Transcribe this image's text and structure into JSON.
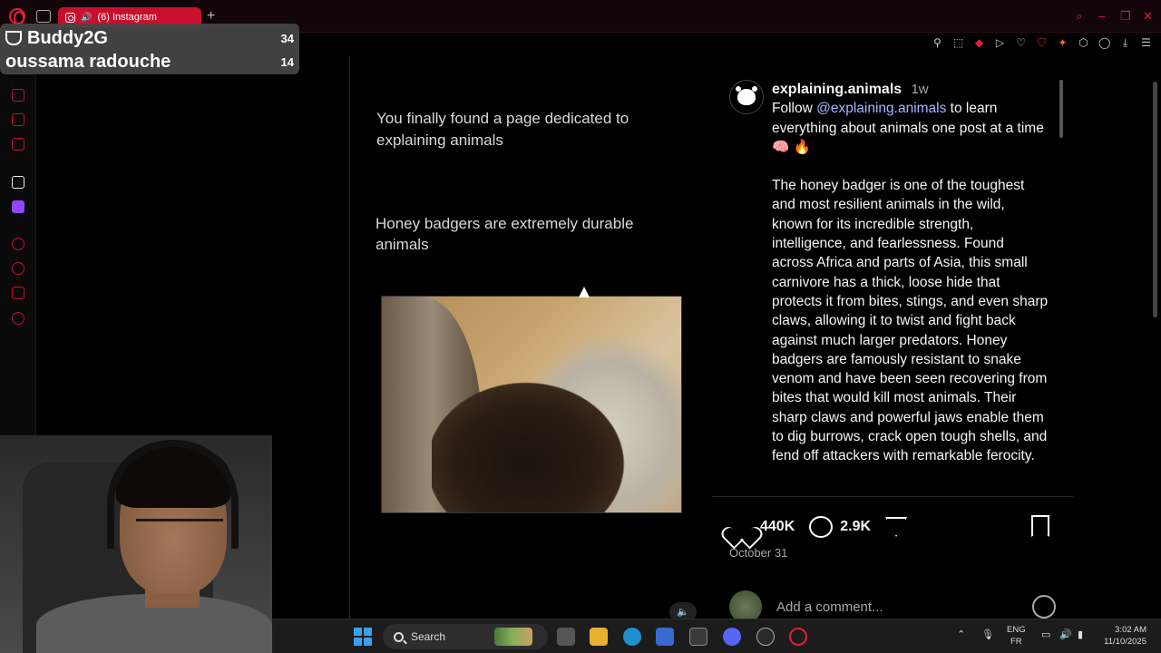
{
  "browser": {
    "tab_title": "(6) Instagram",
    "new_tab": "+",
    "tab_count_icon": "workspace-icon"
  },
  "overlay": {
    "row1_name": "Buddy2G",
    "row1_score": "34",
    "row2_name": "oussama radouche",
    "row2_score": "14"
  },
  "post": {
    "caption_line1": "You finally found a page dedicated to explaining animals",
    "caption_line2": "Honey badgers are extremely durable animals",
    "mute_label": "🔈"
  },
  "panel": {
    "username": "explaining.animals",
    "age": "1w",
    "intro_before": "Follow ",
    "mention": "@explaining.animals",
    "intro_after": " to learn everything about animals one post at a time 🧠 🔥",
    "body": "The honey badger is one of the toughest and most resilient animals in the wild, known for its incredible strength, intelligence, and fearlessness. Found across Africa and parts of Asia, this small carnivore has a thick, loose hide that protects it from bites, stings, and even sharp claws, allowing it to twist and fight back against much larger predators. Honey badgers are famously resistant to snake venom and have been seen recovering from bites that would kill most animals. Their sharp claws and powerful jaws enable them to dig burrows, crack open tough shells, and fend off attackers with remarkable ferocity.",
    "likes": "440K",
    "comments": "2.9K",
    "date": "October 31",
    "comment_placeholder": "Add a comment..."
  },
  "taskbar": {
    "search_label": "Search",
    "lang_line1": "ENG",
    "lang_line2": "FR",
    "time": "3:02 AM",
    "date": "11/10/2025"
  },
  "colors": {
    "opera_red": "#c8102e",
    "mention_blue": "#a0b9ff",
    "windows_blue": "#3aa0f0"
  }
}
